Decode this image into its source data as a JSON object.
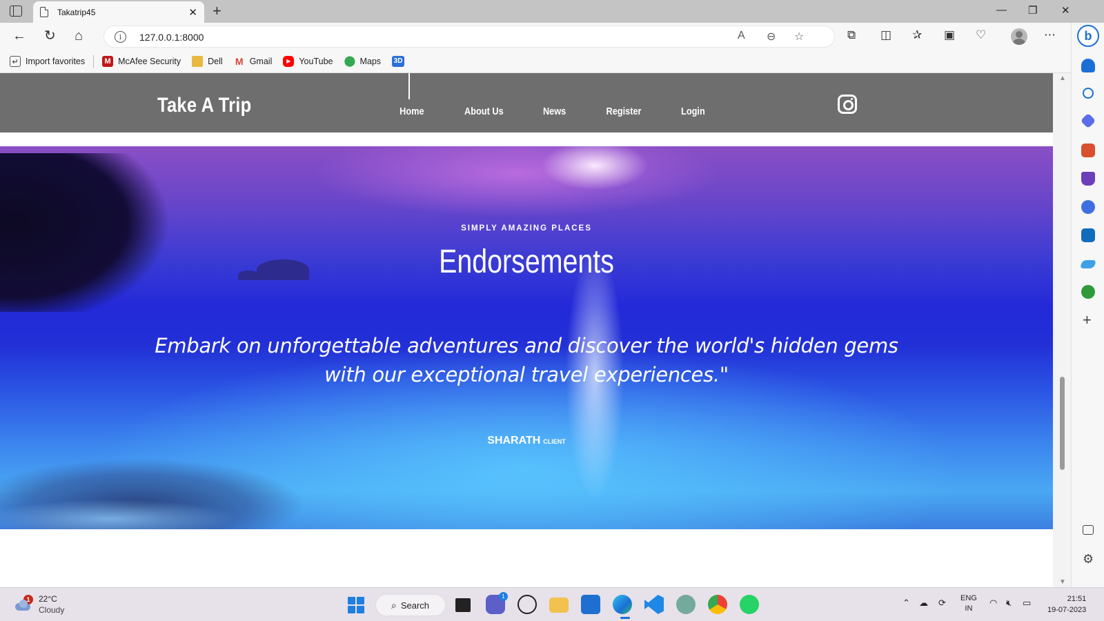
{
  "browser": {
    "tab_title": "Takatrip45",
    "tab_close": "✕",
    "new_tab": "+",
    "url": "127.0.0.1:8000",
    "win_min": "—",
    "win_restore": "❐",
    "win_close": "✕"
  },
  "favorites": [
    {
      "label": "Import favorites",
      "icon": "import-icon",
      "color": "#555555"
    },
    {
      "label": "McAfee Security",
      "icon": "mcafee-icon",
      "color": "#c01818"
    },
    {
      "label": "Dell",
      "icon": "folder-icon",
      "color": "#e8b840"
    },
    {
      "label": "Gmail",
      "icon": "gmail-icon",
      "color": "#d44638"
    },
    {
      "label": "YouTube",
      "icon": "youtube-icon",
      "color": "#ff0000"
    },
    {
      "label": "Maps",
      "icon": "maps-icon",
      "color": "#34a853"
    }
  ],
  "favorites_extra_badge": "3D",
  "site": {
    "brand": "Take A Trip",
    "nav": [
      "Home",
      "About Us",
      "News",
      "Register",
      "Login"
    ],
    "active_nav": "Home"
  },
  "hero": {
    "eyebrow": "SIMPLY AMAZING PLACES",
    "title": "Endorsements",
    "quote": "Embark on unforgettable adventures and discover the world's hidden gems with our exceptional travel experiences.\"",
    "author_name": "SHARATH",
    "author_role": "CLIENT"
  },
  "taskbar": {
    "weather_badge": "1",
    "temperature": "22°C",
    "condition": "Cloudy",
    "search_label": "Search",
    "teams_badge": "1",
    "lang_top": "ENG",
    "lang_bottom": "IN",
    "time": "21:51",
    "date": "19-07-2023"
  },
  "colors": {
    "header_bg": "#6e6e6e",
    "edge_accent": "#1a6fd6"
  }
}
